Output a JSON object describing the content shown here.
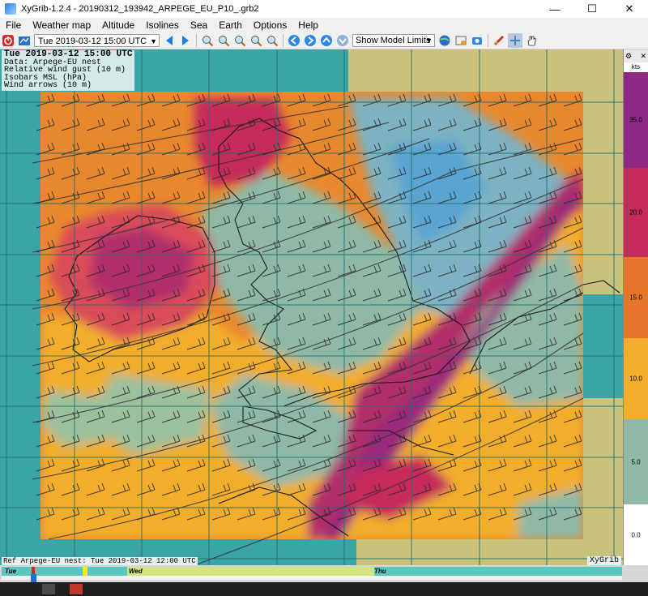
{
  "window": {
    "title": "XyGrib-1.2.4 - 20190312_193942_ARPEGE_EU_P10_.grb2",
    "minimize": "—",
    "maximize": "☐",
    "close": "✕"
  },
  "menu": [
    "File",
    "Weather map",
    "Altitude",
    "Isolines",
    "Sea",
    "Earth",
    "Options",
    "Help"
  ],
  "toolbar": {
    "date_value": "Tue 2019-03-12 15:00 UTC",
    "model_limits_value": "Show Model Limits",
    "icons": [
      "quit-icon",
      "open-file-icon",
      "prev-arrow-icon",
      "next-arrow-icon",
      "zoom-in-icon",
      "zoom-out-icon",
      "zoom-selection-icon",
      "zoom-fit-icon",
      "zoom-all-icon",
      "pan-left-icon",
      "pan-right-icon",
      "pan-up-icon",
      "pan-down-icon",
      "globe-icon",
      "settings-icon",
      "camera-icon",
      "rocket-icon",
      "crosshair-icon",
      "hand-icon"
    ]
  },
  "map_info": {
    "time": "Tue 2019-03-12 15:00 UTC",
    "data": "Data: Arpege-EU nest",
    "layer1": "Relative wind gust (10 m)",
    "layer2": "Isobars MSL (hPa)",
    "layer3": "Wind arrows (10 m)",
    "ref": "Ref Arpege-EU nest: Tue 2019-03-12 12:00 UTC",
    "brand": "XyGrib"
  },
  "legend": {
    "unit": "kts",
    "bands": [
      {
        "label": "35.0",
        "color": "#8e2a86"
      },
      {
        "label": "20.0",
        "color": "#c42a5a"
      },
      {
        "label": "15.0",
        "color": "#e8762a"
      },
      {
        "label": "10.0",
        "color": "#f2ad2a"
      },
      {
        "label": "5.0",
        "color": "#8fb9a6"
      },
      {
        "label": "0.0",
        "color": "#ffffff"
      }
    ]
  },
  "timeline": {
    "days": [
      "Tue",
      "Wed",
      "Thu"
    ],
    "colors": {
      "track": "#58c7c0",
      "day": "#d5e47e",
      "current": "#1c6ed8"
    }
  }
}
